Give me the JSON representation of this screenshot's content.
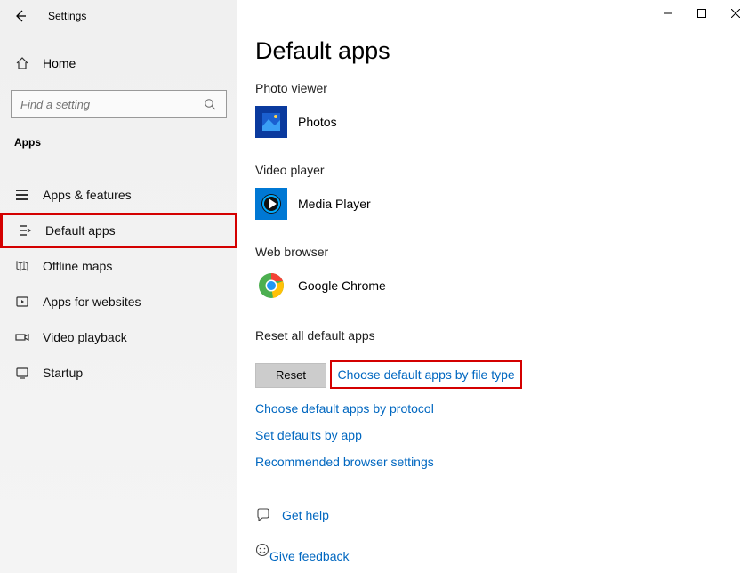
{
  "window": {
    "title": "Settings"
  },
  "sidebar": {
    "home_label": "Home",
    "search_placeholder": "Find a setting",
    "section": "Apps",
    "items": [
      {
        "label": "Apps & features"
      },
      {
        "label": "Default apps"
      },
      {
        "label": "Offline maps"
      },
      {
        "label": "Apps for websites"
      },
      {
        "label": "Video playback"
      },
      {
        "label": "Startup"
      }
    ]
  },
  "page": {
    "title": "Default apps",
    "sections": {
      "photo": {
        "heading": "Photo viewer",
        "app": "Photos"
      },
      "video": {
        "heading": "Video player",
        "app": "Media Player"
      },
      "web": {
        "heading": "Web browser",
        "app": "Google Chrome"
      }
    },
    "reset": {
      "heading": "Reset all default apps",
      "button": "Reset"
    },
    "links": {
      "by_file_type": "Choose default apps by file type",
      "by_protocol": "Choose default apps by protocol",
      "by_app": "Set defaults by app",
      "browser": "Recommended browser settings"
    },
    "help": {
      "get_help": "Get help",
      "feedback": "Give feedback"
    }
  }
}
